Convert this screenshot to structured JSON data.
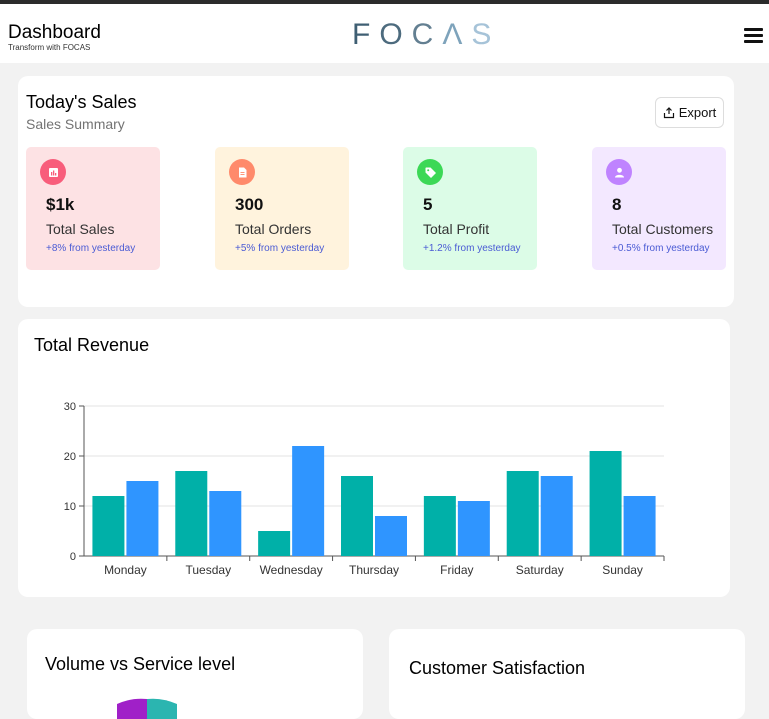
{
  "header": {
    "title": "Dashboard",
    "subtitle": "Transform with FOCAS",
    "logo": [
      "F",
      "O",
      "C",
      "Λ",
      "S"
    ]
  },
  "sales": {
    "title": "Today's Sales",
    "subtitle": "Sales Summary",
    "export_label": "Export",
    "stats": [
      {
        "value": "$1k",
        "label": "Total Sales",
        "change": "+8% from yesterday",
        "icon": "chart-icon",
        "bg": "#fde2e4",
        "icon_bg": "#f85d7b"
      },
      {
        "value": "300",
        "label": "Total Orders",
        "change": "+5% from yesterday",
        "icon": "document-icon",
        "bg": "#fff3dd",
        "icon_bg": "#ff8a6b"
      },
      {
        "value": "5",
        "label": "Total Profit",
        "change": "+1.2% from yesterday",
        "icon": "tag-icon",
        "bg": "#dcfce7",
        "icon_bg": "#3cd856"
      },
      {
        "value": "8",
        "label": "Total Customers",
        "change": "+0.5% from yesterday",
        "icon": "user-icon",
        "bg": "#f3e8ff",
        "icon_bg": "#bf83ff"
      }
    ]
  },
  "revenue": {
    "title": "Total Revenue"
  },
  "chart_data": {
    "type": "bar",
    "categories": [
      "Monday",
      "Tuesday",
      "Wednesday",
      "Thursday",
      "Friday",
      "Saturday",
      "Sunday"
    ],
    "series": [
      {
        "values": [
          12,
          17,
          5,
          16,
          12,
          17,
          21
        ],
        "color": "#00b0a8"
      },
      {
        "values": [
          15,
          13,
          22,
          8,
          11,
          16,
          12
        ],
        "color": "#2f95ff"
      }
    ],
    "yticks": [
      0,
      10,
      20,
      30
    ],
    "ylim": [
      0,
      30
    ],
    "grid": true
  },
  "volume": {
    "title": "Volume vs Service level"
  },
  "satisfaction": {
    "title": "Customer Satisfaction"
  }
}
